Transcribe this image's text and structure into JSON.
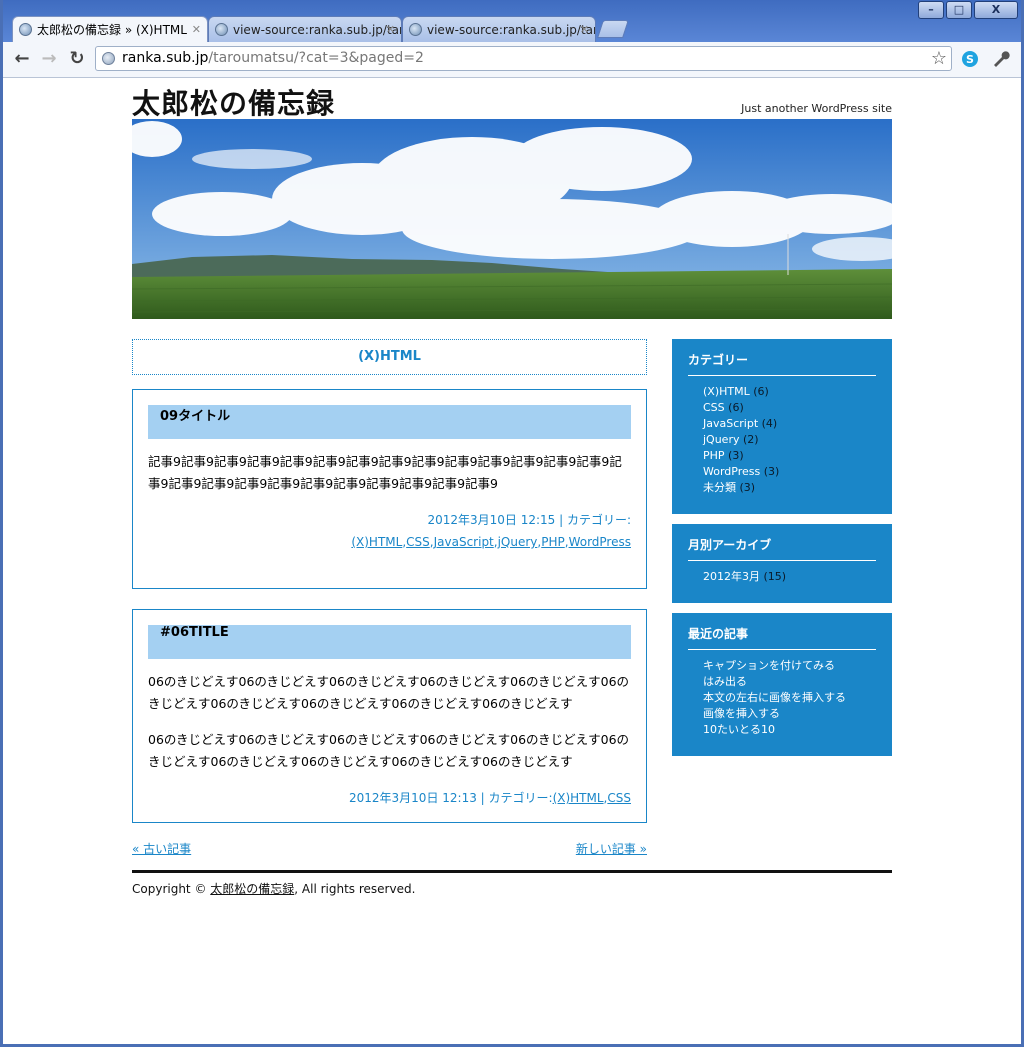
{
  "browser": {
    "tabs": [
      {
        "label": "太郎松の備忘録 » (X)HTML",
        "active": true
      },
      {
        "label": "view-source:ranka.sub.jp/tar",
        "active": false
      },
      {
        "label": "view-source:ranka.sub.jp/tar",
        "active": false
      }
    ],
    "url_host": "ranka.sub.jp",
    "url_path": "/taroumatsu/?cat=3&paged=2",
    "window_buttons": {
      "minimize": "–",
      "maximize": "□",
      "close": "X"
    }
  },
  "site": {
    "title": "太郎松の備忘録",
    "tagline": "Just another WordPress site"
  },
  "category_heading": "(X)HTML",
  "posts": [
    {
      "title": "09タイトル",
      "body": [
        "記事9記事9記事9記事9記事9記事9記事9記事9記事9記事9記事9記事9記事9記事9記事9記事9記事9記事9記事9記事9記事9記事9記事9記事9記事9"
      ],
      "meta_date": "2012年3月10日 12:15 | カテゴリー:",
      "categories": [
        "(X)HTML",
        "CSS",
        "JavaScript",
        "jQuery",
        "PHP",
        "WordPress"
      ]
    },
    {
      "title": "#06TITLE",
      "body": [
        "06のきじどえす06のきじどえす06のきじどえす06のきじどえす06のきじどえす06のきじどえす06のきじどえす06のきじどえす06のきじどえす06のきじどえす",
        "06のきじどえす06のきじどえす06のきじどえす06のきじどえす06のきじどえす06のきじどえす06のきじどえす06のきじどえす06のきじどえす06のきじどえす"
      ],
      "meta_date": "2012年3月10日 12:13 | カテゴリー:",
      "categories": [
        "(X)HTML",
        "CSS"
      ]
    }
  ],
  "pager": {
    "older": "« 古い記事",
    "newer": "新しい記事 »"
  },
  "footer": {
    "prefix": "Copyright © ",
    "link": "太郎松の備忘録",
    "suffix": ", All rights reserved."
  },
  "sidebar": {
    "categories": {
      "title": "カテゴリー",
      "items": [
        {
          "label": "(X)HTML",
          "count": "(6)"
        },
        {
          "label": "CSS",
          "count": "(6)"
        },
        {
          "label": "JavaScript",
          "count": "(4)"
        },
        {
          "label": "jQuery",
          "count": "(2)"
        },
        {
          "label": "PHP",
          "count": "(3)"
        },
        {
          "label": "WordPress",
          "count": "(3)"
        },
        {
          "label": "未分類",
          "count": "(3)"
        }
      ]
    },
    "archives": {
      "title": "月別アーカイブ",
      "items": [
        {
          "label": "2012年3月",
          "count": "(15)"
        }
      ]
    },
    "recent": {
      "title": "最近の記事",
      "items": [
        "キャプションを付けてみる",
        "はみ出る",
        "本文の左右に画像を挿入する",
        "画像を挿入する",
        "10たいとる10"
      ]
    }
  },
  "colors": {
    "accent": "#1a86c8",
    "post_title_bg": "#a4d0f2"
  }
}
